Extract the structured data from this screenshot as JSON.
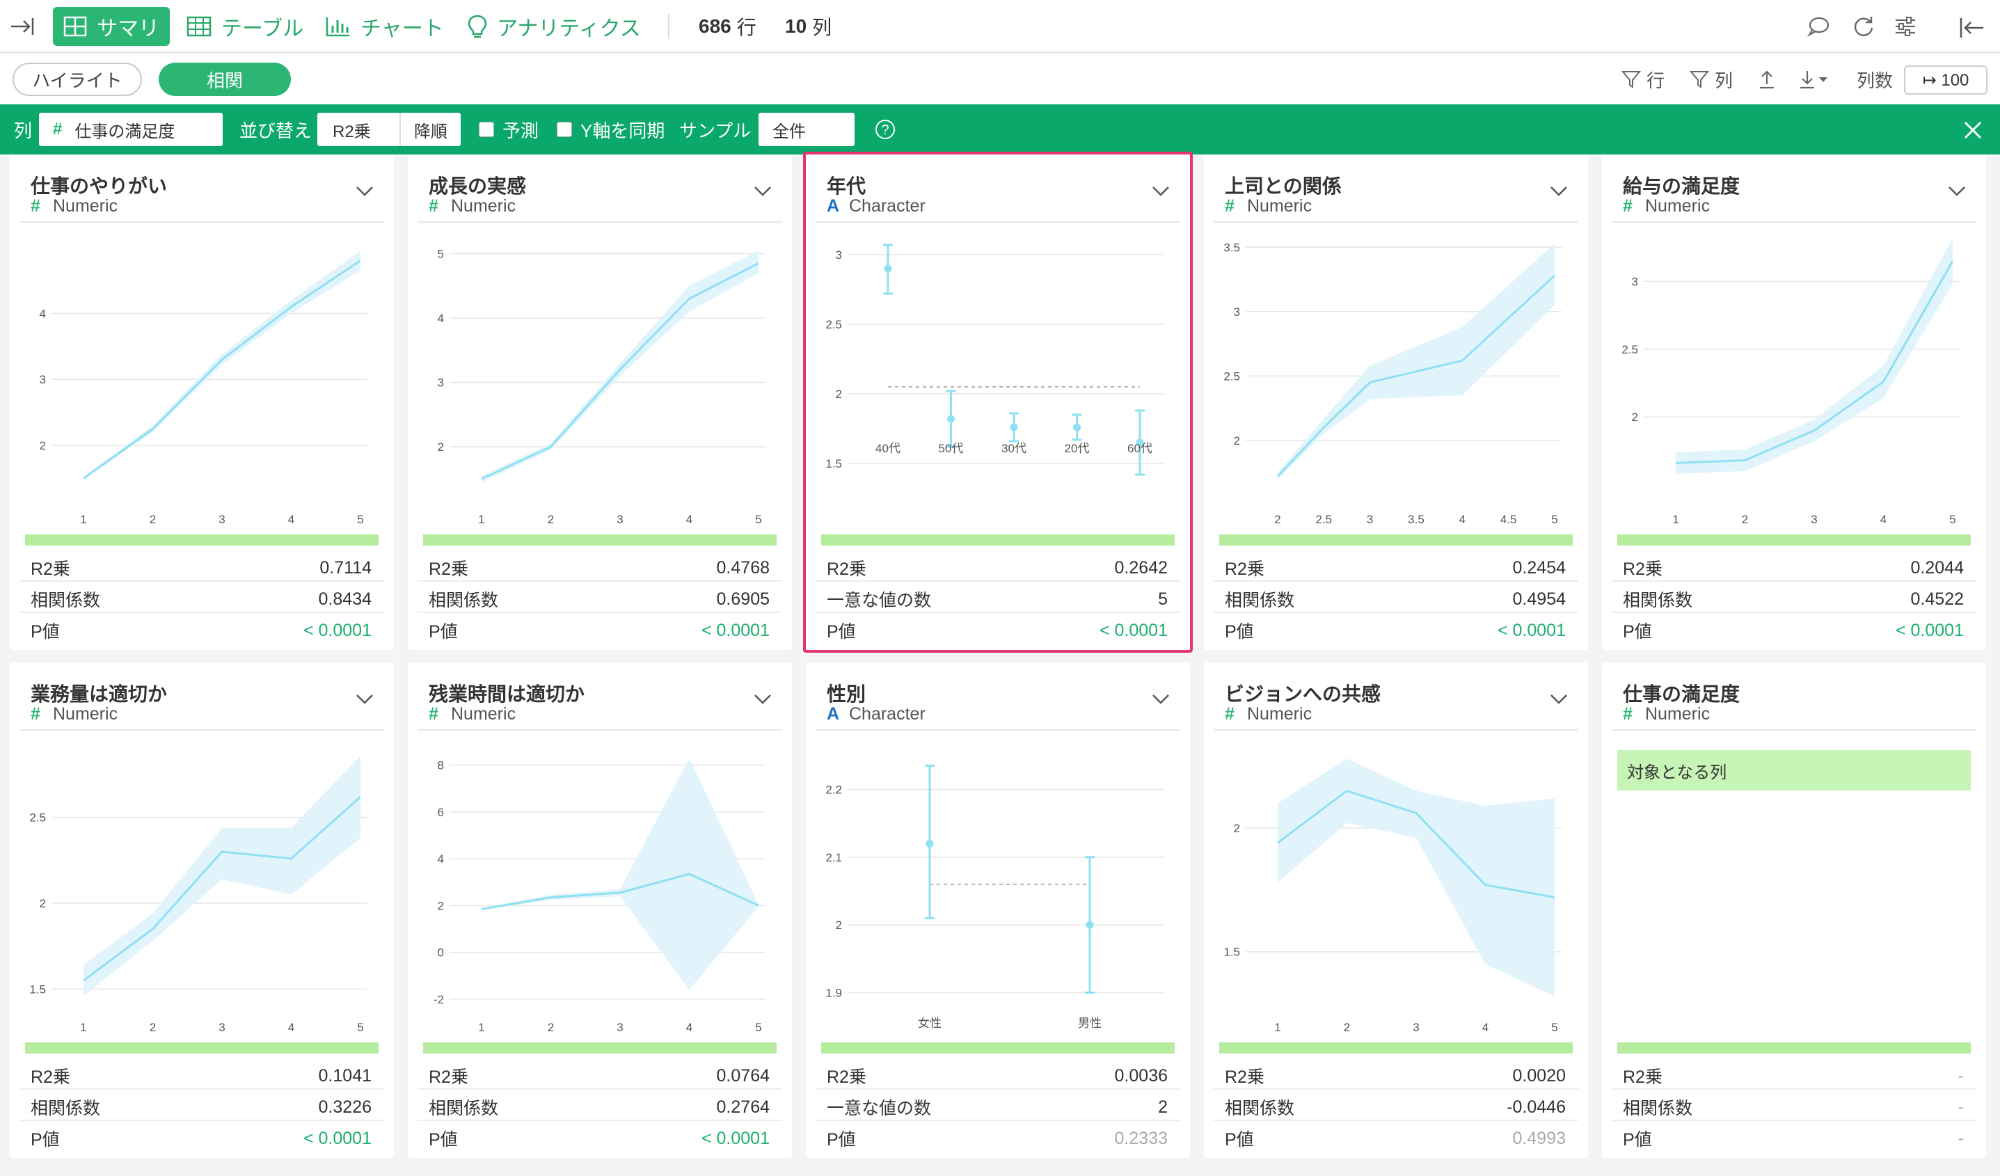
{
  "toolbar": {
    "tabs": [
      {
        "label": "サマリ",
        "icon": "grid-icon"
      },
      {
        "label": "テーブル",
        "icon": "table-icon"
      },
      {
        "label": "チャート",
        "icon": "bar-chart-icon"
      },
      {
        "label": "アナリティクス",
        "icon": "lightbulb-icon"
      }
    ],
    "rows_count": "686",
    "rows_unit": "行",
    "cols_count": "10",
    "cols_unit": "列"
  },
  "subbar": {
    "highlight_label": "ハイライト",
    "corr_label": "相関",
    "filter_row_label": "行",
    "filter_col_label": "列",
    "ncols_label": "列数",
    "ncols_value": "↦ 100"
  },
  "corrbar": {
    "col_label": "列",
    "col_value": "仕事の満足度",
    "sort_label": "並び替え",
    "sort_metric": "R2乗",
    "sort_order": "降順",
    "predict_label": "予測",
    "sync_y_label": "Y軸を同期",
    "sample_label": "サンプル",
    "sample_value": "全件",
    "help": "?"
  },
  "cards": [
    {
      "title": "仕事のやりがい",
      "type": "Numeric",
      "stats": [
        {
          "k": "R2乗",
          "v": "0.7114"
        },
        {
          "k": "相関係数",
          "v": "0.8434"
        },
        {
          "k": "P値",
          "v": "< 0.0001",
          "c": "green"
        }
      ]
    },
    {
      "title": "成長の実感",
      "type": "Numeric",
      "stats": [
        {
          "k": "R2乗",
          "v": "0.4768"
        },
        {
          "k": "相関係数",
          "v": "0.6905"
        },
        {
          "k": "P値",
          "v": "< 0.0001",
          "c": "green"
        }
      ]
    },
    {
      "title": "年代",
      "type": "Character",
      "stats": [
        {
          "k": "R2乗",
          "v": "0.2642"
        },
        {
          "k": "一意な値の数",
          "v": "5"
        },
        {
          "k": "P値",
          "v": "< 0.0001",
          "c": "green"
        }
      ]
    },
    {
      "title": "上司との関係",
      "type": "Numeric",
      "stats": [
        {
          "k": "R2乗",
          "v": "0.2454"
        },
        {
          "k": "相関係数",
          "v": "0.4954"
        },
        {
          "k": "P値",
          "v": "< 0.0001",
          "c": "green"
        }
      ]
    },
    {
      "title": "給与の満足度",
      "type": "Numeric",
      "stats": [
        {
          "k": "R2乗",
          "v": "0.2044"
        },
        {
          "k": "相関係数",
          "v": "0.4522"
        },
        {
          "k": "P値",
          "v": "< 0.0001",
          "c": "green"
        }
      ]
    },
    {
      "title": "業務量は適切か",
      "type": "Numeric",
      "stats": [
        {
          "k": "R2乗",
          "v": "0.1041"
        },
        {
          "k": "相関係数",
          "v": "0.3226"
        },
        {
          "k": "P値",
          "v": "< 0.0001",
          "c": "green"
        }
      ]
    },
    {
      "title": "残業時間は適切か",
      "type": "Numeric",
      "stats": [
        {
          "k": "R2乗",
          "v": "0.0764"
        },
        {
          "k": "相関係数",
          "v": "0.2764"
        },
        {
          "k": "P値",
          "v": "< 0.0001",
          "c": "green"
        }
      ]
    },
    {
      "title": "性別",
      "type": "Character",
      "stats": [
        {
          "k": "R2乗",
          "v": "0.0036"
        },
        {
          "k": "一意な値の数",
          "v": "2"
        },
        {
          "k": "P値",
          "v": "0.2333",
          "c": "gray"
        }
      ]
    },
    {
      "title": "ビジョンへの共感",
      "type": "Numeric",
      "stats": [
        {
          "k": "R2乗",
          "v": "0.0020"
        },
        {
          "k": "相関係数",
          "v": "-0.0446"
        },
        {
          "k": "P値",
          "v": "0.4993",
          "c": "gray"
        }
      ]
    },
    {
      "title": "仕事の満足度",
      "type": "Numeric",
      "target_label": "対象となる列",
      "stats": [
        {
          "k": "R2乗",
          "v": "-",
          "c": "gray"
        },
        {
          "k": "相関係数",
          "v": "-",
          "c": "gray"
        },
        {
          "k": "P値",
          "v": "-",
          "c": "gray"
        }
      ]
    }
  ],
  "chart_data": [
    {
      "type": "line",
      "x": [
        1,
        2,
        3,
        4,
        5
      ],
      "y": [
        1.5,
        2.25,
        3.3,
        4.1,
        4.8
      ],
      "band_low": [
        1.48,
        2.2,
        3.22,
        4.0,
        4.65
      ],
      "band_high": [
        1.53,
        2.3,
        3.38,
        4.2,
        4.95
      ],
      "xlim": [
        1,
        5
      ],
      "ylim": [
        1.2,
        5.1
      ],
      "yticks": [
        2,
        3,
        4
      ]
    },
    {
      "type": "line",
      "x": [
        1,
        2,
        3,
        4,
        5
      ],
      "y": [
        1.5,
        2.0,
        3.2,
        4.3,
        4.85
      ],
      "band_low": [
        1.45,
        1.95,
        3.1,
        4.1,
        4.7
      ],
      "band_high": [
        1.55,
        2.05,
        3.3,
        4.5,
        5.05
      ],
      "xlim": [
        1,
        5
      ],
      "ylim": [
        1.2,
        5.2
      ],
      "yticks": [
        2,
        3,
        4,
        5
      ]
    },
    {
      "type": "errorbar",
      "categories": [
        "40代",
        "50代",
        "30代",
        "20代",
        "60代"
      ],
      "values": [
        2.9,
        1.82,
        1.76,
        1.76,
        1.65
      ],
      "err_low": [
        2.72,
        1.62,
        1.66,
        1.67,
        1.42
      ],
      "err_high": [
        3.07,
        2.02,
        1.86,
        1.85,
        1.88
      ],
      "ref": 2.05,
      "ylim": [
        1.25,
        3.1
      ],
      "yticks": [
        1.5,
        2,
        2.5,
        3
      ]
    },
    {
      "type": "line",
      "x": [
        2,
        2.5,
        3,
        4,
        5
      ],
      "y": [
        1.72,
        2.1,
        2.45,
        2.62,
        3.28
      ],
      "band_low": [
        1.7,
        2.05,
        2.32,
        2.35,
        3.05
      ],
      "band_high": [
        1.75,
        2.17,
        2.58,
        2.88,
        3.53
      ],
      "xlim": [
        2,
        5
      ],
      "ylim": [
        1.55,
        3.55
      ],
      "yticks": [
        2,
        2.5,
        3,
        3.5
      ],
      "xticks": [
        2,
        2.5,
        3,
        3.5,
        4,
        4.5,
        5
      ]
    },
    {
      "type": "line",
      "x": [
        1,
        2,
        3,
        4,
        5
      ],
      "y": [
        1.66,
        1.68,
        1.9,
        2.26,
        3.15
      ],
      "band_low": [
        1.58,
        1.6,
        1.82,
        2.14,
        2.98
      ],
      "band_high": [
        1.74,
        1.76,
        1.98,
        2.38,
        3.32
      ],
      "xlim": [
        1,
        5
      ],
      "ylim": [
        1.4,
        3.3
      ],
      "yticks": [
        2,
        2.5,
        3
      ]
    },
    {
      "type": "line",
      "x": [
        1,
        2,
        3,
        4,
        5
      ],
      "y": [
        1.55,
        1.85,
        2.3,
        2.26,
        2.62
      ],
      "band_low": [
        1.46,
        1.78,
        2.14,
        2.05,
        2.38
      ],
      "band_high": [
        1.64,
        1.94,
        2.44,
        2.44,
        2.86
      ],
      "xlim": [
        1,
        5
      ],
      "ylim": [
        1.4,
        2.9
      ],
      "yticks": [
        1.5,
        2,
        2.5
      ]
    },
    {
      "type": "line",
      "x": [
        1,
        2,
        3,
        4,
        5
      ],
      "y": [
        1.85,
        2.35,
        2.55,
        3.35,
        2.0
      ],
      "band_low": [
        1.8,
        2.25,
        2.4,
        -1.6,
        1.95
      ],
      "band_high": [
        1.9,
        2.45,
        2.7,
        8.3,
        2.05
      ],
      "xlim": [
        1,
        5
      ],
      "ylim": [
        -2.3,
        8.7
      ],
      "yticks": [
        -2,
        0,
        2,
        4,
        6,
        8
      ]
    },
    {
      "type": "errorbar",
      "categories": [
        "女性",
        "男性"
      ],
      "values": [
        2.12,
        2.0
      ],
      "err_low": [
        2.01,
        1.9
      ],
      "err_high": [
        2.235,
        2.1
      ],
      "ref": 2.06,
      "ylim": [
        1.88,
        2.26
      ],
      "yticks": [
        1.9,
        2,
        2.1,
        2.2
      ]
    },
    {
      "type": "line",
      "x": [
        1,
        2,
        3,
        4,
        5
      ],
      "y": [
        1.94,
        2.15,
        2.06,
        1.77,
        1.72
      ],
      "band_low": [
        1.78,
        2.02,
        1.96,
        1.45,
        1.32
      ],
      "band_high": [
        2.1,
        2.28,
        2.15,
        2.09,
        2.12
      ],
      "xlim": [
        1,
        5
      ],
      "ylim": [
        1.28,
        2.32
      ],
      "yticks": [
        1.5,
        2
      ]
    }
  ]
}
